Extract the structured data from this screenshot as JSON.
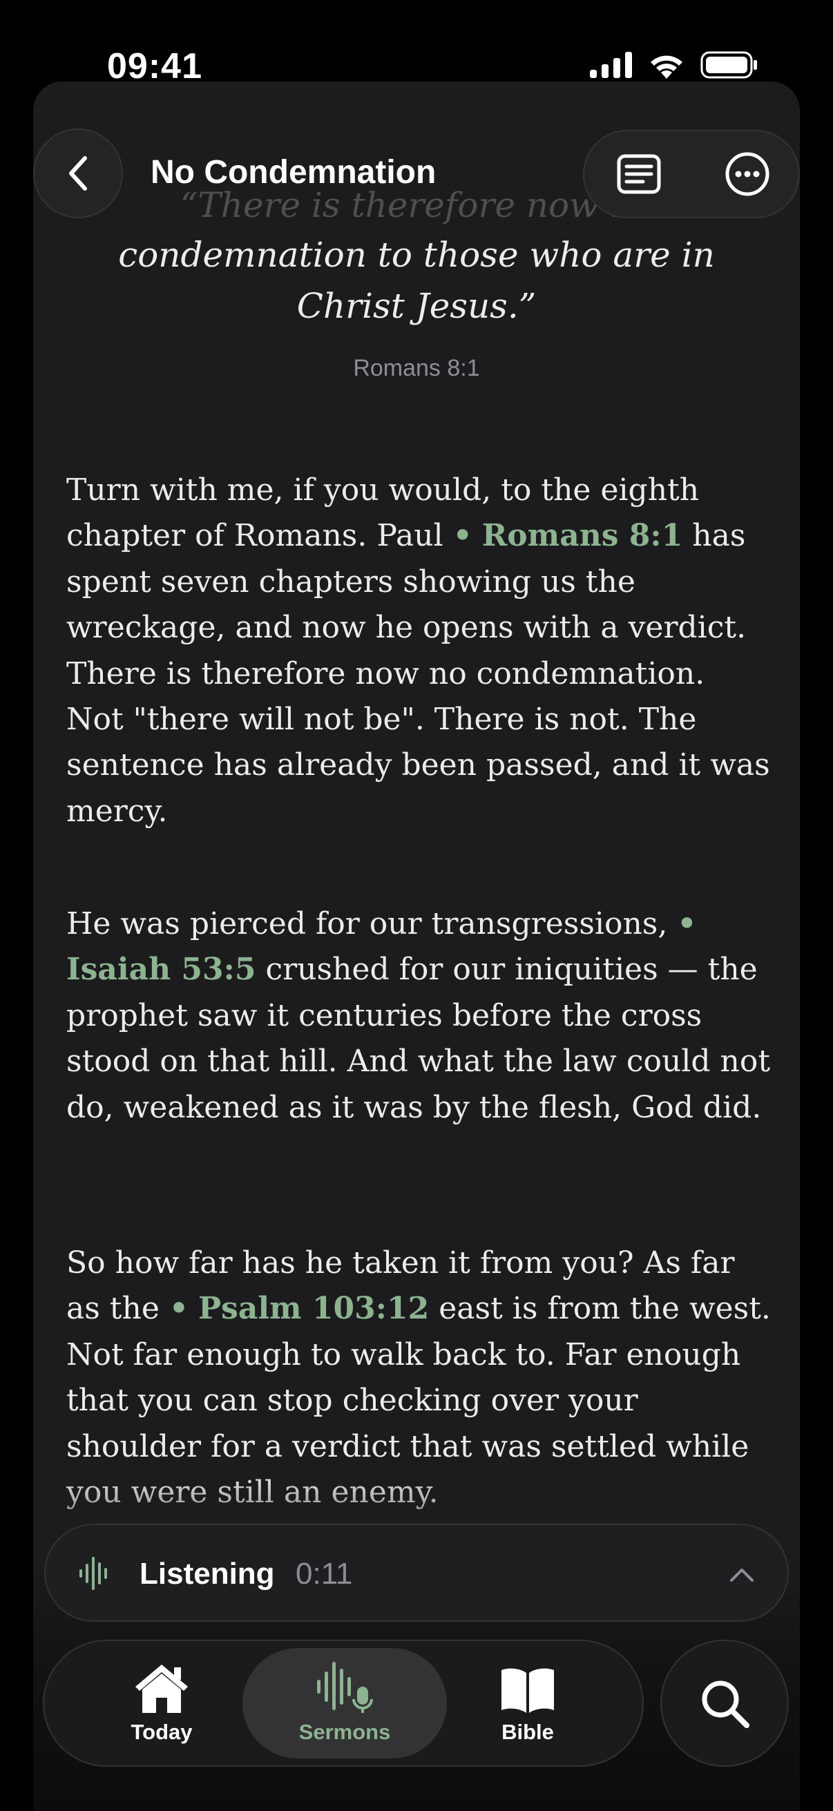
{
  "status": {
    "time": "09:41"
  },
  "header": {
    "title": "No Condemnation"
  },
  "verse": {
    "line1": "“There is therefore now no",
    "line2": "condemnation to those who are in",
    "line3": "Christ Jesus.”",
    "reference": "Romans 8:1"
  },
  "sermon": {
    "p1": {
      "a": "Turn with me, if you would, to the eighth chapter of Romans. Paul ",
      "ref": "Romans 8:1",
      "b": " has spent seven chapters showing us the wreckage, and now he opens with a verdict. There is therefore now no condemnation. Not \"there will not be\". There is not. The sentence has already been passed, and it was mercy."
    },
    "p2": {
      "a": "He was pierced for our transgressions, ",
      "ref": "Isaiah 53:5",
      "b": " crushed for our iniquities — the prophet saw it centuries before the cross stood on that hill. And what the law could not do, weakened as it was by the flesh, God did."
    },
    "p3": {
      "a": "So how far has he taken it from you? As far as the ",
      "ref": "Psalm 103:12",
      "b": " east is from the west. Not far enough to walk back to. Far enough that you can stop checking over your shoulder for a verdict that was settled while you were still an enemy."
    },
    "bullet": "•"
  },
  "player": {
    "label": "Listening",
    "time": "0:11"
  },
  "tabs": {
    "today": "Today",
    "sermons": "Sermons",
    "bible": "Bible"
  },
  "colors": {
    "accent": "#8db391",
    "background": "#1c1c1e",
    "text": "#ececec",
    "secondary": "#8e8e93"
  }
}
